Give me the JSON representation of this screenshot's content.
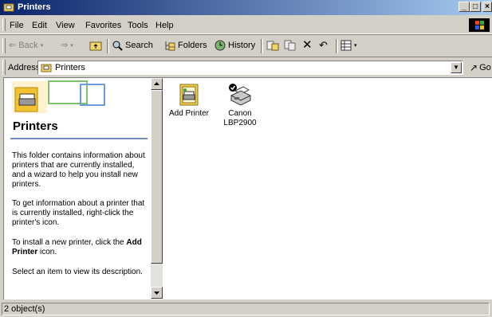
{
  "window": {
    "title": "Printers"
  },
  "menu": [
    {
      "label": "File"
    },
    {
      "label": "Edit"
    },
    {
      "label": "View"
    },
    {
      "label": "Favorites"
    },
    {
      "label": "Tools"
    },
    {
      "label": "Help"
    }
  ],
  "toolbar": {
    "back": "Back",
    "search": "Search",
    "folders": "Folders",
    "history": "History"
  },
  "address": {
    "label": "Address",
    "value": "Printers",
    "go": "Go"
  },
  "sidepanel": {
    "title": "Printers",
    "p1": "This folder contains information about printers that are currently installed, and a wizard to help you install new printers.",
    "p2": "To get information about a printer that is currently installed, right-click the printer's icon.",
    "p3_prefix": "To install a new printer, click the",
    "p3_bold": "Add Printer",
    "p3_suffix": "icon.",
    "p4": "Select an item to view its description."
  },
  "items": [
    {
      "label": "Add Printer",
      "icon": "add-printer-icon"
    },
    {
      "label": "Canon LBP2900",
      "icon": "printer-icon"
    }
  ],
  "status": {
    "text": "2 object(s)"
  }
}
